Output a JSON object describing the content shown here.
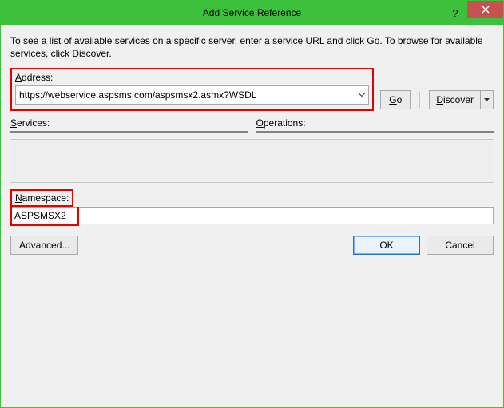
{
  "window": {
    "title": "Add Service Reference"
  },
  "instructions": "To see a list of available services on a specific server, enter a service URL and click Go. To browse for available services, click Discover.",
  "address": {
    "label_pre": "A",
    "label_post": "ddress:",
    "value": "https://webservice.aspsms.com/aspsmsx2.asmx?WSDL"
  },
  "buttons": {
    "go_pre": "G",
    "go_post": "o",
    "discover_pre": "D",
    "discover_post": "iscover",
    "advanced": "Advanced...",
    "ok": "OK",
    "cancel": "Cancel"
  },
  "lists": {
    "services_label_pre": "S",
    "services_label_post": "ervices:",
    "operations_label_pre": "O",
    "operations_label_post": "perations:"
  },
  "namespace": {
    "label_pre": "N",
    "label_post": "amespace:",
    "value": "ASPSMSX2"
  }
}
